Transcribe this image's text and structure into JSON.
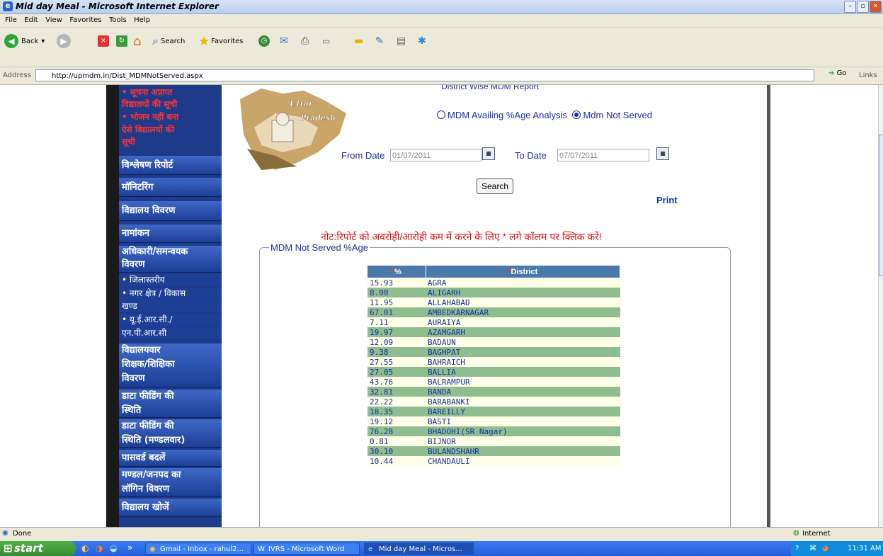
{
  "window": {
    "title": "Mid day Meal - Microsoft Internet Explorer"
  },
  "menu": [
    "File",
    "Edit",
    "View",
    "Favorites",
    "Tools",
    "Help"
  ],
  "toolbar": {
    "back": "Back",
    "search": "Search",
    "favorites": "Favorites"
  },
  "address": {
    "label": "Address",
    "url": "http://upmdm.in/Dist_MDMNotServed.aspx",
    "go": "Go",
    "links": "Links"
  },
  "sidebar": {
    "red_items": [
      "• सूचना अप्राप्त",
      "विद्यालयों की सूची",
      "• भोजन नहीं बना",
      "ऐसे विद्यालयों की",
      "सूची"
    ],
    "items": [
      "विश्लेषण रिपोर्ट",
      "मॉनिटरिंग",
      "विद्यालय विवरण",
      "नामांकन"
    ],
    "officer": [
      "अधिकारी/समन्वयक",
      "विवरण"
    ],
    "sub": [
      "• जिलास्तरीय",
      "• नगर क्षेत्र / विकास",
      "खण्ड",
      "• यू.ई.आर.सी./",
      "एन.पी.आर.सी"
    ],
    "lower": [
      [
        "विद्यालयवार",
        "शिक्षक/शिक्षिका",
        "विवरण"
      ],
      [
        "डाटा फीडिंग की",
        "स्थिति"
      ],
      [
        "डाटा फीडिंग की",
        "स्थिति (मण्डलवार)"
      ],
      [
        "पासवर्ड बदलें"
      ],
      [
        "मण्डल/जनपद का",
        "लॉगिन विवरण"
      ],
      [
        "विद्यालय खोजें"
      ]
    ]
  },
  "logo": {
    "line1": "Uttar",
    "line2": "Pradesh"
  },
  "report": {
    "title": "District Wise MDM Report",
    "radio1": "MDM Availing %Age Analysis",
    "radio2": "Mdm Not Served",
    "from_label": "From Date",
    "from_value": "01/07/2011",
    "to_label": "To Date",
    "to_value": "07/07/2011",
    "search": "Search",
    "print": "Print",
    "note": "नोट:रिपोर्ट को अवरोही/आरोही कम में करने के लिए * लगे कॉलम पर क्लिक करें!",
    "fieldset_legend": "MDM Not Served %Age"
  },
  "table": {
    "headers": {
      "star": "*",
      "pct": "%",
      "district": "District"
    },
    "rows": [
      [
        "15.93",
        "AGRA"
      ],
      [
        "8.08",
        "ALIGARH"
      ],
      [
        "11.95",
        "ALLAHABAD"
      ],
      [
        "67.01",
        "AMBEDKARNAGAR"
      ],
      [
        "7.11",
        "AURAIYA"
      ],
      [
        "19.97",
        "AZAMGARH"
      ],
      [
        "12.09",
        "BADAUN"
      ],
      [
        "9.38",
        "BAGHPAT"
      ],
      [
        "27.55",
        "BAHRAICH"
      ],
      [
        "27.05",
        "BALLIA"
      ],
      [
        "43.76",
        "BALRAMPUR"
      ],
      [
        "32.81",
        "BANDA"
      ],
      [
        "22.22",
        "BARABANKI"
      ],
      [
        "18.35",
        "BAREILLY"
      ],
      [
        "19.12",
        "BASTI"
      ],
      [
        "76.28",
        "BHADOHI(SR Nagar)"
      ],
      [
        "0.81",
        "BIJNOR"
      ],
      [
        "30.10",
        "BULANDSHAHR"
      ],
      [
        "10.44",
        "CHANDAULI"
      ]
    ]
  },
  "status": {
    "left": "Done",
    "zone": "Internet"
  },
  "taskbar": {
    "start": "start",
    "tasks": [
      "Gmail - Inbox - rahul2...",
      "IVRS - Microsoft Word",
      "Mid day Meal - Micros..."
    ],
    "time": "11:31 AM"
  }
}
